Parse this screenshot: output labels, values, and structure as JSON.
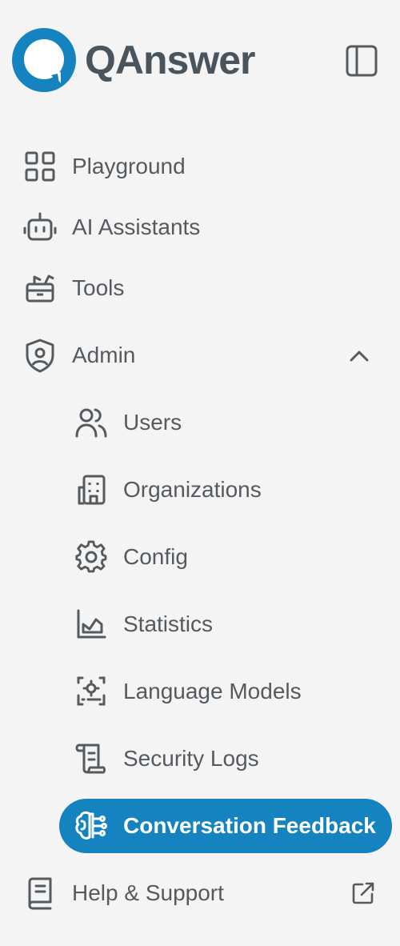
{
  "brand": {
    "name": "QAnswer",
    "accent": "#1483bf"
  },
  "nav": {
    "playground": "Playground",
    "assistants": "AI Assistants",
    "tools": "Tools",
    "admin": "Admin",
    "help": "Help & Support"
  },
  "admin_items": {
    "users": "Users",
    "organizations": "Organizations",
    "config": "Config",
    "statistics": "Statistics",
    "language_models": "Language Models",
    "security_logs": "Security Logs",
    "conversation_feedback": "Conversation Feedback"
  },
  "icons": {
    "collapse": "sidebar-toggle-icon",
    "playground": "grid-icon",
    "assistants": "robot-icon",
    "tools": "toolbox-icon",
    "admin": "shield-user-icon",
    "chevron": "chevron-up-icon",
    "users": "users-icon",
    "organizations": "building-icon",
    "config": "gear-icon",
    "statistics": "chart-area-icon",
    "language_models": "server-cog-icon",
    "security_logs": "scroll-icon",
    "conversation_feedback": "brain-icon",
    "help": "book-icon",
    "external": "external-link-icon"
  }
}
